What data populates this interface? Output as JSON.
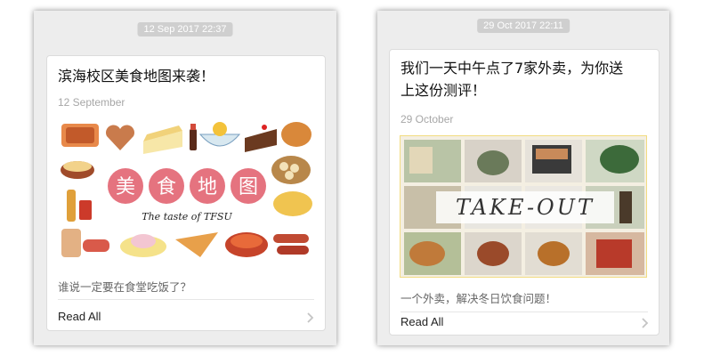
{
  "left_article": {
    "timestamp": "12 Sep 2017 22:37",
    "title": "滨海校区美食地图来袭！",
    "date": "12 September",
    "cover": {
      "heading_chars": [
        "美",
        "食",
        "地",
        "图"
      ],
      "subtitle": "The taste of TFSU"
    },
    "description": "谁说一定要在食堂吃饭了？",
    "read_all_label": "Read All"
  },
  "right_article": {
    "timestamp": "29 Oct 2017 22:11",
    "title_line1": "我们一天中午点了7家外卖，为你送",
    "title_line2": "上这份测评！",
    "date": "29 October",
    "cover": {
      "logo_text": "TAKE-OUT"
    },
    "description": "一个外卖，解决冬日饮食问题！",
    "read_all_label": "Read All"
  },
  "colors": {
    "panel_bg": "#ededed",
    "timestamp_bg": "#cfcfcf",
    "heading_circle": "#e5737f",
    "takeout_border": "#f2dc82"
  }
}
